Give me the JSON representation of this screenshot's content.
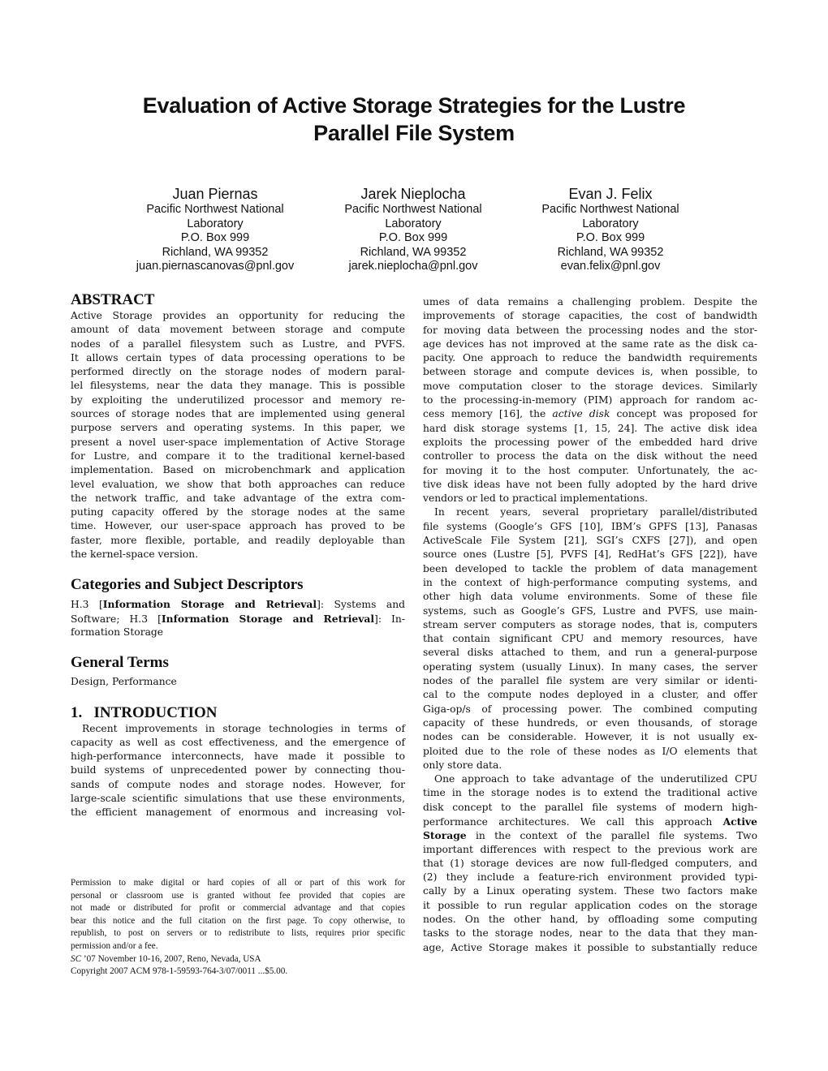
{
  "paper": {
    "title_lines": [
      "Evaluation of Active Storage Strategies for the Lustre",
      "Parallel File System"
    ],
    "authors": [
      {
        "name": "Juan Piernas",
        "affiliation_lines": [
          "Pacific Northwest National",
          "Laboratory"
        ],
        "address_lines": [
          "P.O. Box 999",
          "Richland, WA 99352"
        ],
        "email": "juan.piernascanovas@pnl.gov"
      },
      {
        "name": "Jarek Nieplocha",
        "affiliation_lines": [
          "Pacific Northwest National",
          "Laboratory"
        ],
        "address_lines": [
          "P.O. Box 999",
          "Richland, WA 99352"
        ],
        "email": "jarek.nieplocha@pnl.gov"
      },
      {
        "name": "Evan J. Felix",
        "affiliation_lines": [
          "Pacific Northwest National",
          "Laboratory"
        ],
        "address_lines": [
          "P.O. Box 999",
          "Richland, WA 99352"
        ],
        "email": "evan.felix@pnl.gov"
      }
    ],
    "abstract": {
      "heading": "ABSTRACT",
      "lines": [
        "Active Storage provides an opportunity for reducing the",
        "amount of data movement between storage and compute",
        "nodes of a parallel filesystem such as Lustre, and PVFS.",
        "It allows certain types of data processing operations to be",
        "performed directly on the storage nodes of modern paral-",
        "lel filesystems, near the data they manage. This is possible",
        "by exploiting the underutilized processor and memory re-",
        "sources of storage nodes that are implemented using general",
        "purpose servers and operating systems. In this paper, we",
        "present a novel user-space implementation of Active Storage",
        "for Lustre, and compare it to the traditional kernel-based",
        "implementation. Based on microbenchmark and application",
        "level evaluation, we show that both approaches can reduce",
        "the network traffic, and take advantage of the extra com-",
        "puting capacity offered by the storage nodes at the same",
        "time. However, our user-space approach has proved to be",
        "faster, more flexible, portable, and readily deployable than",
        "the kernel-space version."
      ]
    },
    "categories": {
      "heading": "Categories and Subject Descriptors",
      "line1_pre": "H.3 [",
      "line1_bold": "Information Storage and Retrieval",
      "line1_post": "]: Systems and",
      "line2_pre": "Software; H.3 [",
      "line2_bold": "Information Storage and Retrieval",
      "line2_post": "]: In-",
      "line3": "formation Storage"
    },
    "general_terms": {
      "heading": "General Terms",
      "text": "Design, Performance"
    },
    "introduction": {
      "heading": "1.   INTRODUCTION",
      "left_lines": [
        "Recent improvements in storage technologies in terms of",
        "capacity as well as cost effectiveness, and the emergence of",
        "high-performance interconnects, have made it possible to",
        "build systems of unprecedented power by connecting thou-",
        "sands of compute nodes and storage nodes. However, for",
        "large-scale scientific simulations that use these environments,",
        "the efficient management of enormous and increasing vol-"
      ],
      "right_p1_lines_a": [
        "umes of data remains a challenging problem. Despite the",
        "improvements of storage capacities, the cost of bandwidth",
        "for moving data between the processing nodes and the stor-",
        "age devices has not improved at the same rate as the disk ca-",
        "pacity. One approach to reduce the bandwidth requirements",
        "between storage and compute devices is, when possible, to",
        "move computation closer to the storage devices. Similarly",
        "to the processing-in-memory (PIM) approach for random ac-"
      ],
      "right_p1_italic_line": {
        "pre": "cess memory [16], the ",
        "italic": "active disk",
        "post": " concept was proposed for"
      },
      "right_p1_lines_b": [
        "hard disk storage systems [1, 15, 24]. The active disk idea",
        "exploits the processing power of the embedded hard drive",
        "controller to process the data on the disk without the need",
        "for moving it to the host computer. Unfortunately, the ac-",
        "tive disk ideas have not been fully adopted by the hard drive",
        "vendors or led to practical implementations."
      ],
      "right_p2_lines": [
        "In recent years, several proprietary parallel/distributed",
        "file systems (Google’s GFS [10], IBM’s GPFS [13], Panasas",
        "ActiveScale File System [21], SGI’s CXFS [27]), and open",
        "source ones (Lustre [5], PVFS [4], RedHat’s GFS [22]), have",
        "been developed to tackle the problem of data management",
        "in the context of high-performance computing systems, and",
        "other high data volume environments. Some of these file",
        "systems, such as Google’s GFS, Lustre and PVFS, use main-",
        "stream server computers as storage nodes, that is, computers",
        "that contain significant CPU and memory resources, have",
        "several disks attached to them, and run a general-purpose",
        "operating system (usually Linux). In many cases, the server",
        "nodes of the parallel file system are very similar or identi-",
        "cal to the compute nodes deployed in a cluster, and offer",
        "Giga-op/s of processing power. The combined computing",
        "capacity of these hundreds, or even thousands, of storage",
        "nodes can be considerable. However, it is not usually ex-",
        "ploited due to the role of these nodes as I/O elements that",
        "only store data."
      ],
      "right_p3_lines_a": [
        "One approach to take advantage of the underutilized CPU",
        "time in the storage nodes is to extend the traditional active",
        "disk concept to the parallel file systems of modern high-"
      ],
      "right_p3_bold_line": {
        "pre": "performance architectures. We call this approach ",
        "bold": "Active"
      },
      "right_p3_bold_line2": {
        "bold": "Storage",
        "post": " in the context of the parallel file systems. Two"
      },
      "right_p3_lines_b": [
        "important differences with respect to the previous work are",
        "that (1) storage devices are now full-fledged computers, and",
        "(2) they include a feature-rich environment provided typi-",
        "cally by a Linux operating system. These two factors make",
        "it possible to run regular application codes on the storage",
        "nodes. On the other hand, by offloading some computing",
        "tasks to the storage nodes, near to the data that they man-",
        "age, Active Storage makes it possible to substantially reduce"
      ]
    },
    "permission": {
      "lines": [
        "Permission to make digital or hard copies of all or part of this work for",
        "personal or classroom use is granted without fee provided that copies are",
        "not made or distributed for profit or commercial advantage and that copies",
        "bear this notice and the full citation on the first page. To copy otherwise, to",
        "republish, to post on servers or to redistribute to lists, requires prior specific",
        "permission and/or a fee."
      ],
      "conf_italic": "SC",
      "conf_rest": " ’07 November 10-16, 2007, Reno, Nevada, USA",
      "copyright": "Copyright 2007 ACM 978-1-59593-764-3/07/0011 ...$5.00."
    }
  }
}
